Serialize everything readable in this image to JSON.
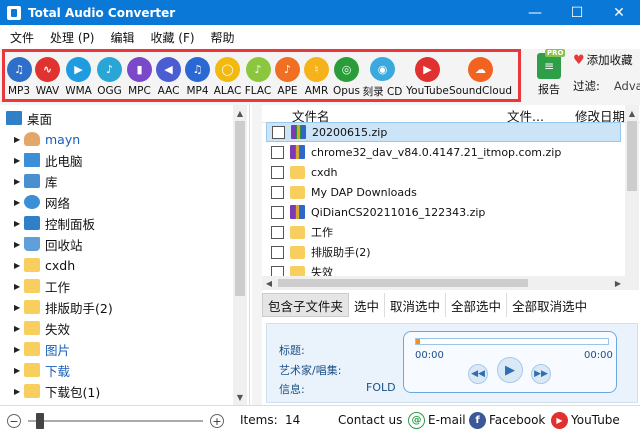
{
  "window": {
    "title": "Total Audio Converter",
    "minimize": "—",
    "maximize": "☐",
    "close": "✕"
  },
  "menu": [
    "文件",
    "处理 (P)",
    "编辑",
    "收藏 (F)",
    "帮助"
  ],
  "formats": [
    {
      "label": "MP3",
      "color": "#2f6fc9",
      "glyph": "♫"
    },
    {
      "label": "WAV",
      "color": "#e0322f",
      "glyph": "∿"
    },
    {
      "label": "WMA",
      "color": "#1f9be0",
      "glyph": "▶"
    },
    {
      "label": "OGG",
      "color": "#2aa6d6",
      "glyph": "♪"
    },
    {
      "label": "MPC",
      "color": "#7a48c8",
      "glyph": "▮"
    },
    {
      "label": "AAC",
      "color": "#4a5ed1",
      "glyph": "◀"
    },
    {
      "label": "MP4",
      "color": "#2b68d4",
      "glyph": "♫"
    },
    {
      "label": "ALAC",
      "color": "#f2b90f",
      "glyph": "◯"
    },
    {
      "label": "FLAC",
      "color": "#8cc63f",
      "glyph": "♪"
    },
    {
      "label": "APE",
      "color": "#f06f22",
      "glyph": "♪"
    },
    {
      "label": "AMR",
      "color": "#f6b21b",
      "glyph": "♮"
    },
    {
      "label": "Opus",
      "color": "#2a9d3a",
      "glyph": "◎"
    },
    {
      "label": "刻录 CD",
      "color": "#3aa9de",
      "glyph": "◉"
    },
    {
      "label": "YouTube",
      "color": "#e03030",
      "glyph": "▶"
    },
    {
      "label": "SoundCloud",
      "color": "#f26322",
      "glyph": "☁"
    }
  ],
  "toolbar": {
    "report_label": "报告",
    "pro_badge": "PRO",
    "add_favorite": "添加收藏",
    "filter_label": "过滤:",
    "filter_value": "Adva"
  },
  "tree": [
    {
      "label": "桌面",
      "icon": "desk",
      "indent": 0,
      "arrow": "",
      "blue": false
    },
    {
      "label": "mayn",
      "icon": "user",
      "indent": 1,
      "arrow": "▶",
      "blue": true
    },
    {
      "label": "此电脑",
      "icon": "pc",
      "indent": 1,
      "arrow": "▶",
      "blue": false
    },
    {
      "label": "库",
      "icon": "lib",
      "indent": 1,
      "arrow": "▶",
      "blue": false
    },
    {
      "label": "网络",
      "icon": "net",
      "indent": 1,
      "arrow": "▶",
      "blue": false
    },
    {
      "label": "控制面板",
      "icon": "cp",
      "indent": 1,
      "arrow": "▶",
      "blue": false
    },
    {
      "label": "回收站",
      "icon": "bin",
      "indent": 1,
      "arrow": "▶",
      "blue": false
    },
    {
      "label": "cxdh",
      "icon": "folder",
      "indent": 1,
      "arrow": "▶",
      "blue": false
    },
    {
      "label": "工作",
      "icon": "folder",
      "indent": 1,
      "arrow": "▶",
      "blue": false
    },
    {
      "label": "排版助手(2)",
      "icon": "folder",
      "indent": 1,
      "arrow": "▶",
      "blue": false
    },
    {
      "label": "失效",
      "icon": "folder",
      "indent": 1,
      "arrow": "▶",
      "blue": false
    },
    {
      "label": "图片",
      "icon": "folder",
      "indent": 1,
      "arrow": "▶",
      "blue": true
    },
    {
      "label": "下载",
      "icon": "folder",
      "indent": 1,
      "arrow": "▶",
      "blue": true
    },
    {
      "label": "下载包(1)",
      "icon": "folder",
      "indent": 1,
      "arrow": "▶",
      "blue": false
    }
  ],
  "file_list": {
    "columns": [
      "文件名",
      "文件...",
      "修改日期"
    ],
    "rows": [
      {
        "name": "20200615.zip",
        "type": "zip",
        "selected": true
      },
      {
        "name": "chrome32_dav_v84.0.4147.21_itmop.com.zip",
        "type": "zip",
        "selected": false
      },
      {
        "name": "cxdh",
        "type": "folder",
        "selected": false
      },
      {
        "name": "My DAP Downloads",
        "type": "folder",
        "selected": false
      },
      {
        "name": "QiDianCS20211016_122343.zip",
        "type": "zip",
        "selected": false
      },
      {
        "name": "工作",
        "type": "folder",
        "selected": false
      },
      {
        "name": "排版助手(2)",
        "type": "folder",
        "selected": false
      },
      {
        "name": "失效",
        "type": "folder",
        "selected": false
      }
    ]
  },
  "selection_buttons": [
    "包含子文件夹",
    "选中",
    "取消选中",
    "全部选中",
    "全部取消选中"
  ],
  "info": {
    "title_label": "标题:",
    "artist_label": "艺术家/唱集:",
    "info_label": "信息:",
    "info_value": "FOLD",
    "time_start": "00:00",
    "time_end": "00:00",
    "progress": 0.02
  },
  "status": {
    "zoom_minus": "−",
    "zoom_plus": "+",
    "items_label": "Items:",
    "items_count": "14",
    "contact": "Contact us",
    "email": "E-mail",
    "facebook": "Facebook",
    "youtube": "YouTube"
  }
}
